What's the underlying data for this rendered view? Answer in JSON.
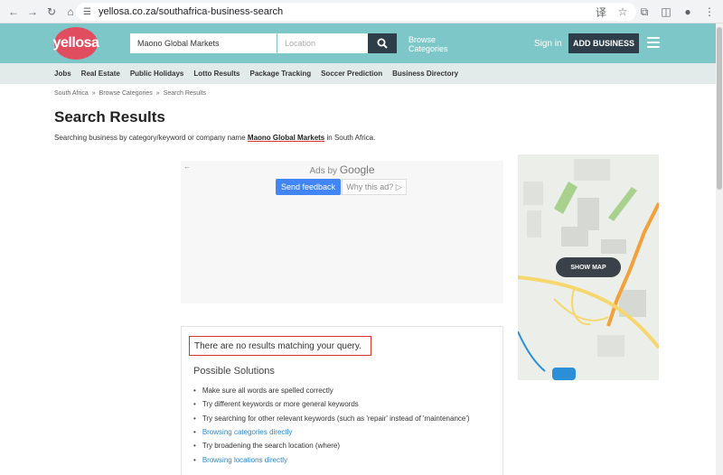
{
  "browser": {
    "url": "yellosa.co.za/southafrica-business-search"
  },
  "header": {
    "logo_text": "yellosa",
    "search_value": "Maono Global Markets",
    "location_placeholder": "Location",
    "browse_line1": "Browse",
    "browse_line2": "Categories",
    "signin": "Sign in",
    "add_business": "ADD BUSINESS",
    "brand_color": "#7ec7c9",
    "logo_color": "#e04d5e"
  },
  "nav": {
    "items": [
      "Jobs",
      "Real Estate",
      "Public Holidays",
      "Lotto Results",
      "Package Tracking",
      "Soccer Prediction",
      "Business Directory"
    ]
  },
  "breadcrumb": {
    "items": [
      "South Africa",
      "Browse Categories",
      "Search Results"
    ],
    "separator": "»"
  },
  "main": {
    "title": "Search Results",
    "search_prefix": "Searching business by category/keyword or company name",
    "search_query": "Maono Global Markets",
    "search_suffix": "in South Africa."
  },
  "ads": {
    "back": "←",
    "ads_by": "Ads by",
    "google": "Google",
    "send_feedback": "Send feedback",
    "why_this_ad": "Why this ad? ▷"
  },
  "map": {
    "show_map": "SHOW MAP"
  },
  "results": {
    "no_results": "There are no results matching your query.",
    "possible_heading": "Possible Solutions",
    "solutions": [
      {
        "text": "Make sure all words are spelled correctly",
        "link": false
      },
      {
        "text": "Try different keywords or more general keywords",
        "link": false
      },
      {
        "text": "Try searching for other relevant keywords (such as 'repair' instead of 'maintenance')",
        "link": false
      },
      {
        "text": "Browsing categories directly",
        "link": true
      },
      {
        "text": "Try broadening the search location (where)",
        "link": false
      },
      {
        "text": "Browsing locations directly",
        "link": true
      }
    ]
  }
}
